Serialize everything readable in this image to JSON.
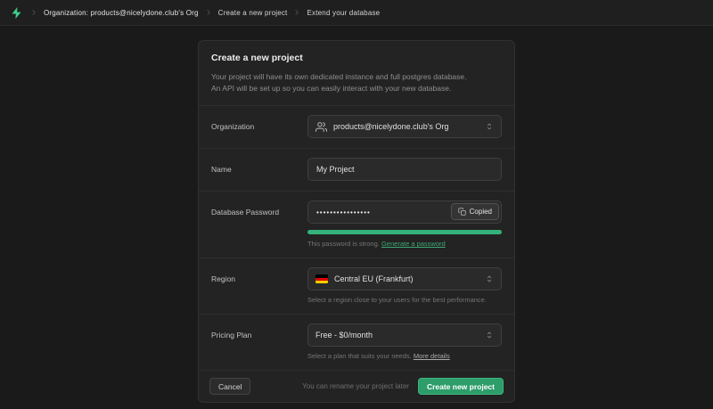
{
  "topbar": {
    "logo_name": "supabase-bolt",
    "breadcrumbs": [
      "Organization: products@nicelydone.club's Org",
      "Create a new project",
      "Extend your database"
    ]
  },
  "panel": {
    "title": "Create a new project",
    "description_line1": "Your project will have its own dedicated instance and full postgres database.",
    "description_line2": "An API will be set up so you can easily interact with your new database.",
    "fields": {
      "organization": {
        "label": "Organization",
        "value": "products@nicelydone.club's Org",
        "icon": "users-icon"
      },
      "name": {
        "label": "Name",
        "value": "My Project"
      },
      "password": {
        "label": "Database Password",
        "value": "••••••••••••••••",
        "copied_label": "Copied",
        "strength_text": "This password is strong.",
        "generate_link": "Generate a password"
      },
      "region": {
        "label": "Region",
        "value": "Central EU (Frankfurt)",
        "helper": "Select a region close to your users for the best performance."
      },
      "plan": {
        "label": "Pricing Plan",
        "value": "Free - $0/month",
        "helper": "Select a plan that suits your needs.",
        "more_link": "More details"
      }
    },
    "footer": {
      "cancel_label": "Cancel",
      "note": "You can rename your project later",
      "submit_label": "Create new project"
    }
  },
  "colors": {
    "accent_green": "#3ecf8e",
    "button_green": "#2d9d69",
    "strength_bar_green": "#34b27b",
    "link_green": "#3ea672",
    "flag_stripes": [
      "#000000",
      "#dd0000",
      "#ffce00"
    ]
  }
}
